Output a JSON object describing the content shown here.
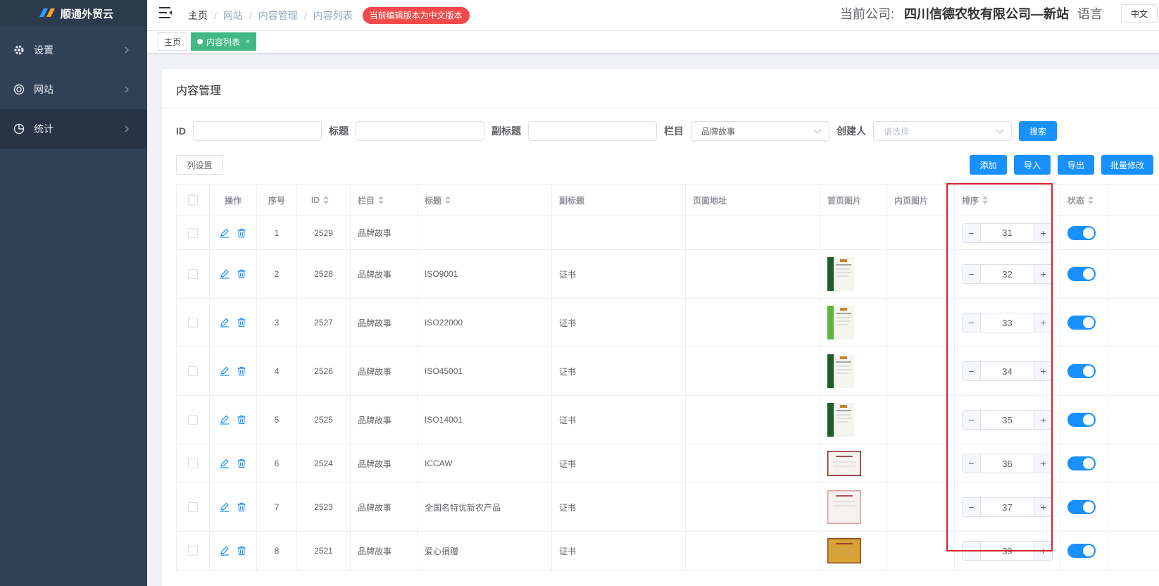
{
  "app": {
    "logo_text": "顺通外贸云"
  },
  "sidebar": {
    "items": [
      {
        "label": "设置",
        "icon": "gear-icon"
      },
      {
        "label": "网站",
        "icon": "globe-icon"
      },
      {
        "label": "统计",
        "icon": "pie-chart-icon"
      }
    ]
  },
  "header": {
    "breadcrumb": [
      "主页",
      "网站",
      "内容管理",
      "内容列表"
    ],
    "notice": "当前编辑版本为中文版本",
    "company_label": "当前公司:",
    "company_name": "四川信德农牧有限公司—新站",
    "language_label": "语言",
    "language_value": "中文"
  },
  "tags": {
    "home": "主页",
    "active": "内容列表",
    "close": "×"
  },
  "card": {
    "title": "内容管理"
  },
  "filters": {
    "id_label": "ID",
    "title_label": "标题",
    "subtitle_label": "副标题",
    "column_label": "栏目",
    "column_value": "品牌故事",
    "creator_label": "创建人",
    "creator_placeholder": "请选择",
    "search_button": "搜索"
  },
  "toolbar": {
    "column_settings": "列设置",
    "add": "添加",
    "import": "导入",
    "export": "导出",
    "batch_edit": "批量修改"
  },
  "table": {
    "headers": {
      "ops": "操作",
      "seq": "序号",
      "id": "ID",
      "column": "栏目",
      "title": "标题",
      "subtitle": "副标题",
      "url": "页面地址",
      "home_img": "首页图片",
      "inner_img": "内页图片",
      "sort": "排序",
      "status": "状态"
    },
    "rows": [
      {
        "seq": "1",
        "id": "2529",
        "column": "品牌故事",
        "title": "",
        "subtitle": "",
        "sort": "31",
        "has_image": false,
        "status_on": true
      },
      {
        "seq": "2",
        "id": "2528",
        "column": "品牌故事",
        "title": "ISO9001",
        "subtitle": "证书",
        "sort": "32",
        "has_image": true,
        "status_on": true
      },
      {
        "seq": "3",
        "id": "2527",
        "column": "品牌故事",
        "title": "ISO22000",
        "subtitle": "证书",
        "sort": "33",
        "has_image": true,
        "status_on": true
      },
      {
        "seq": "4",
        "id": "2526",
        "column": "品牌故事",
        "title": "ISO45001",
        "subtitle": "证书",
        "sort": "34",
        "has_image": true,
        "status_on": true
      },
      {
        "seq": "5",
        "id": "2525",
        "column": "品牌故事",
        "title": "ISO14001",
        "subtitle": "证书",
        "sort": "35",
        "has_image": true,
        "status_on": true
      },
      {
        "seq": "6",
        "id": "2524",
        "column": "品牌故事",
        "title": "ICCAW",
        "subtitle": "证书",
        "sort": "36",
        "has_image": true,
        "status_on": true
      },
      {
        "seq": "7",
        "id": "2523",
        "column": "品牌故事",
        "title": "全国名特优新农产品",
        "subtitle": "证书",
        "sort": "37",
        "has_image": true,
        "status_on": true
      },
      {
        "seq": "8",
        "id": "2521",
        "column": "品牌故事",
        "title": "爱心捐赠",
        "subtitle": "证书",
        "sort": "39",
        "has_image": true,
        "status_on": true
      }
    ]
  },
  "colors": {
    "primary": "#1890ff",
    "sidebar": "#304156",
    "tag_active": "#42b983",
    "notice": "#f24a4a",
    "highlight": "#d9232c"
  }
}
